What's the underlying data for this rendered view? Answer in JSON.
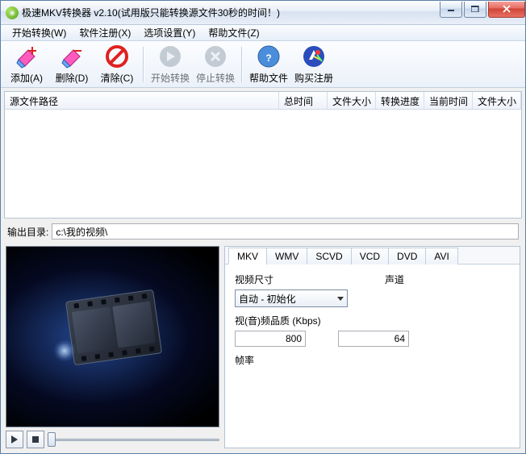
{
  "title": "极速MKV转换器 v2.10(试用版只能转换源文件30秒的时间！)",
  "menu": {
    "start": "开始转换(W)",
    "register": "软件注册(X)",
    "options": "选项设置(Y)",
    "help": "帮助文件(Z)"
  },
  "toolbar": {
    "add": "添加(A)",
    "delete": "删除(D)",
    "clear": "清除(C)",
    "start": "开始转换",
    "stop": "停止转换",
    "help": "帮助文件",
    "buy": "购买注册"
  },
  "table": {
    "columns": {
      "path": "源文件路径",
      "total_time": "总时间",
      "file_size": "文件大小",
      "progress": "转换进度",
      "current_time": "当前时间",
      "out_size": "文件大小"
    }
  },
  "output": {
    "label": "输出目录:",
    "value": "c:\\我的视频\\"
  },
  "tabs": {
    "mkv": "MKV",
    "wmv": "WMV",
    "scvd": "SCVD",
    "vcd": "VCD",
    "dvd": "DVD",
    "avi": "AVI"
  },
  "settings": {
    "video_size_label": "视频尺寸",
    "video_size_value": "自动 - 初始化",
    "audio_channel_label": "声道",
    "bitrate_label": "视(音)频品质 (Kbps)",
    "video_bitrate": "800",
    "audio_bitrate": "64",
    "fps_label": "帧率"
  }
}
